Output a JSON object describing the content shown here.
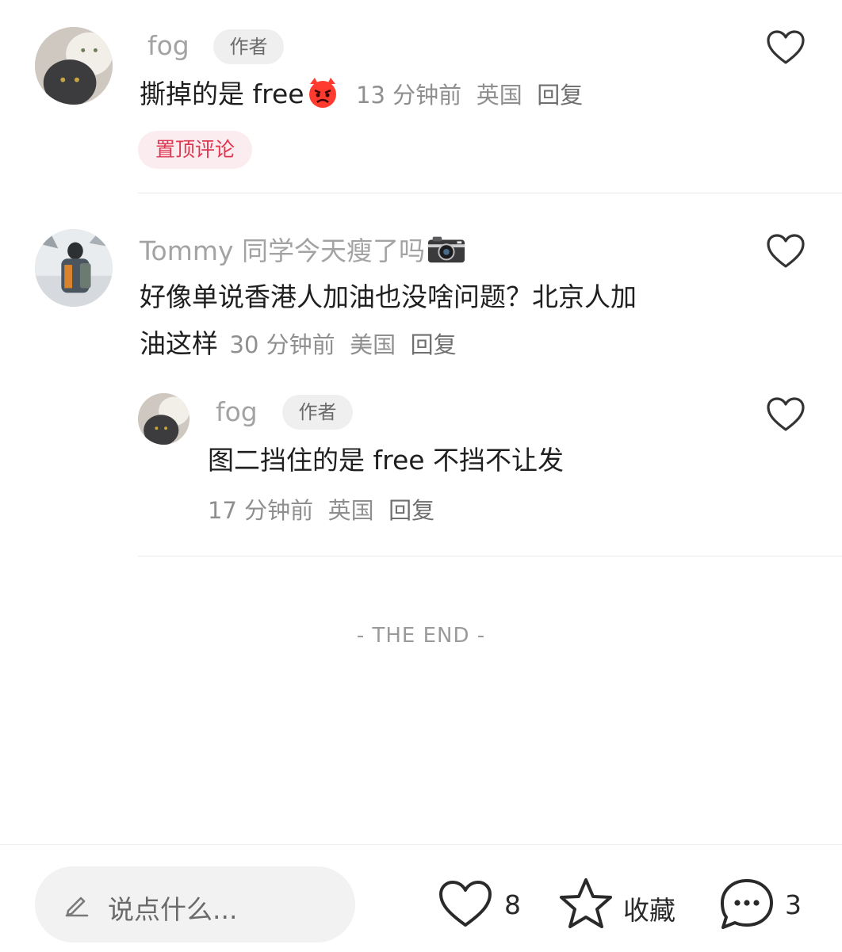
{
  "comments": [
    {
      "username": "fog",
      "author_tag": "作者",
      "text": "撕掉的是 free",
      "emoji": "angry-face-emoji",
      "time": "13 分钟前",
      "location": "英国",
      "reply": "回复",
      "pinned_label": "置顶评论"
    },
    {
      "username": "Tommy 同学今天瘦了吗",
      "username_emoji": "camera-emoji",
      "text_line1": "好像单说香港人加油也没啥问题？北京人加",
      "text_line2": "油这样",
      "time": "30 分钟前",
      "location": "美国",
      "reply": "回复",
      "replies": [
        {
          "username": "fog",
          "author_tag": "作者",
          "text": "图二挡住的是 free 不挡不让发",
          "time": "17 分钟前",
          "location": "英国",
          "reply": "回复"
        }
      ]
    }
  ],
  "end_text": "- THE END -",
  "bottom_bar": {
    "input_placeholder": "说点什么...",
    "like_count": "8",
    "collect_label": "收藏",
    "comment_count": "3"
  },
  "colors": {
    "pin_text": "#e0364f",
    "pin_bg": "#fbecef",
    "username": "#a3a3a3",
    "meta": "#8f8f8f"
  }
}
